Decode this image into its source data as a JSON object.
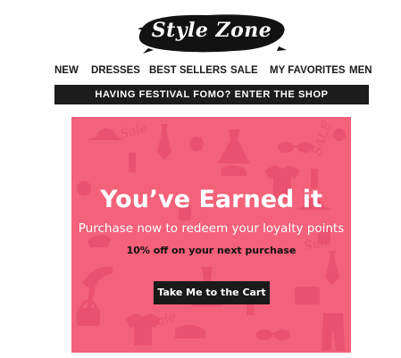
{
  "brand": {
    "name": "Style Zone",
    "logo_icon": "brush-stroke-logo"
  },
  "nav": {
    "items": [
      {
        "label": "NEW"
      },
      {
        "label": "DRESSES"
      },
      {
        "label": "BEST SELLERS"
      },
      {
        "label": "SALE"
      },
      {
        "label": "MY FAVORITES"
      },
      {
        "label": "MEN"
      }
    ]
  },
  "banner": {
    "text": "HAVING FESTIVAL FOMO? ENTER THE SHOP",
    "background": "#1c1c1c"
  },
  "hero": {
    "background": "#f3617a",
    "title": "You’ve Earned it",
    "subtitle": "Purchase now to redeem your loyalty points",
    "offer": "10% off on your next purchase",
    "cta_label": "Take Me to the Cart",
    "pattern_icons": [
      "high-heel-icon",
      "handbag-icon",
      "dress-icon",
      "sunglasses-icon",
      "hat-icon",
      "tie-icon",
      "lipstick-icon",
      "shirt-icon",
      "sale-tag-icon"
    ]
  }
}
